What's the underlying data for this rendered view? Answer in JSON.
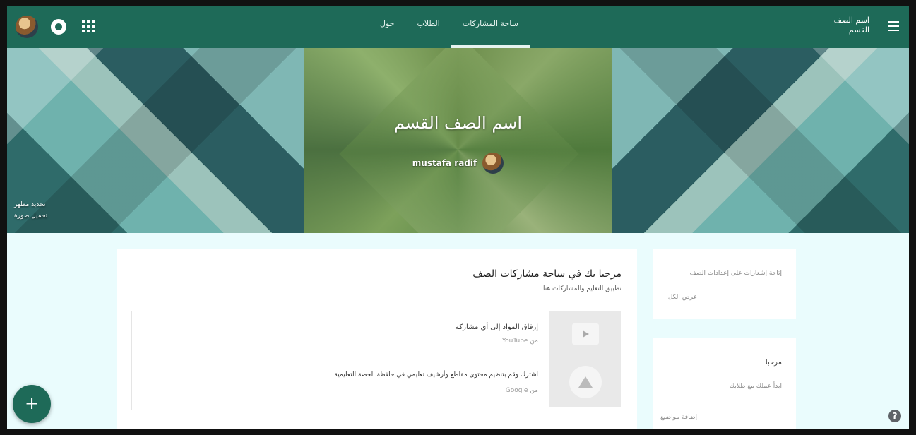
{
  "header": {
    "tabs": [
      {
        "label": "ساحة المشاركات",
        "active": true
      },
      {
        "label": "الطلاب",
        "active": false
      },
      {
        "label": "حول",
        "active": false
      }
    ],
    "class_title_line1": "اسم الصف",
    "class_title_line2": "القسم",
    "menu_icon": "hamburger-icon",
    "apps_icon": "apps-grid-icon",
    "circle_icon": "circle-icon",
    "accent_color": "#1e6a58"
  },
  "banner": {
    "title": "اسم الصف القسم",
    "teacher_name": "mustafa radif",
    "theme_links": [
      "تحديد مظهر",
      "تحميل صورة"
    ]
  },
  "main": {
    "welcome_title": "مرحبا بك في ساحة مشاركات الصف",
    "welcome_subtitle": "تطبيق التعليم والمشاركات هنا",
    "items": [
      {
        "title": "إرفاق المواد إلى أي مشاركة",
        "source": "YouTube من"
      },
      {
        "title": "اشترك وقم بتنظيم محتوى مقاطع وأرشيف تعليمي في حافظة الحصة التعليمية",
        "source": "Google من"
      }
    ]
  },
  "sidebar": {
    "card1": {
      "line1": "إتاحة إشعارات على إعدادات الصف",
      "line2": "عرض الكل"
    },
    "card2": {
      "title": "مرحبا",
      "line1": "ابدأ عملك مع طلابك",
      "line2": "إضافة مواضيع"
    }
  },
  "fab": {
    "label": "+"
  },
  "help": {
    "label": "?"
  }
}
